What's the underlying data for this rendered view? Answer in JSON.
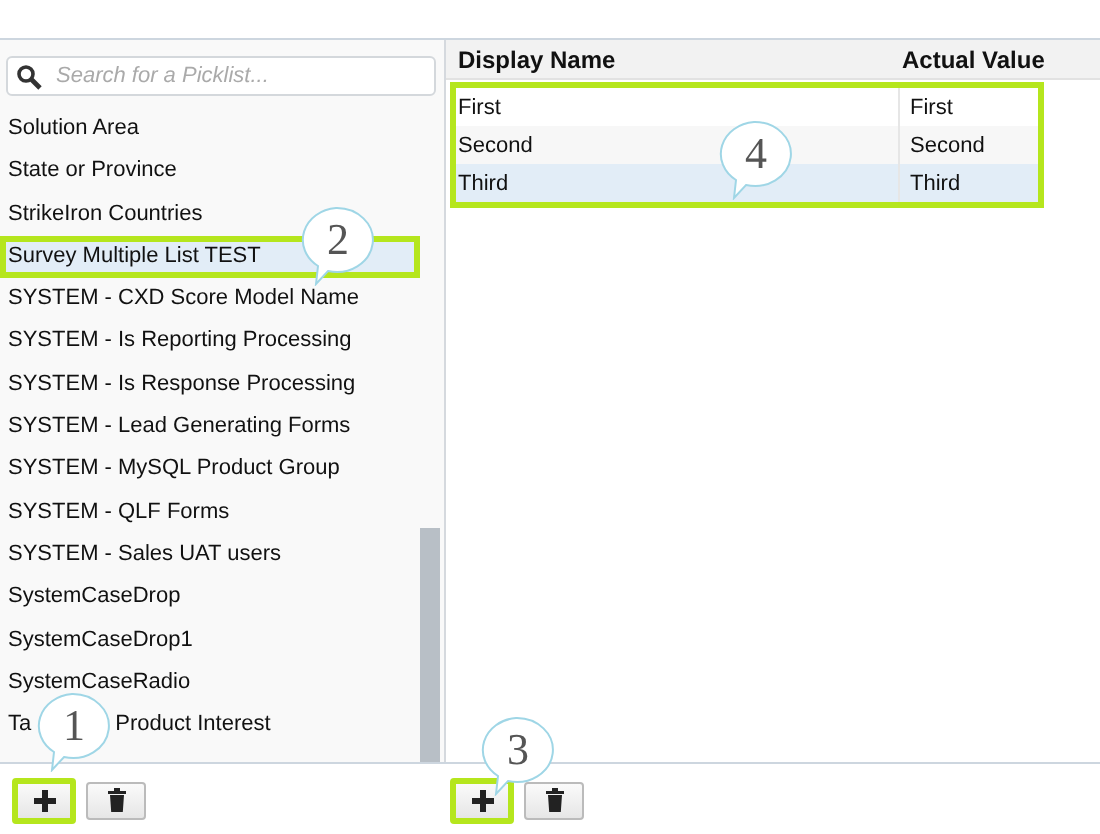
{
  "search": {
    "placeholder": "Search for a Picklist..."
  },
  "picklists": [
    {
      "label": "Solution Area",
      "selected": false,
      "highlighted": false
    },
    {
      "label": "State or Province",
      "selected": false,
      "highlighted": false
    },
    {
      "label": "StrikeIron Countries",
      "selected": false,
      "highlighted": false
    },
    {
      "label": "Survey Multiple List TEST",
      "selected": true,
      "highlighted": true
    },
    {
      "label": "SYSTEM - CXD Score Model Name",
      "selected": false,
      "highlighted": false
    },
    {
      "label": "SYSTEM - Is Reporting Processing",
      "selected": false,
      "highlighted": false
    },
    {
      "label": "SYSTEM - Is Response Processing",
      "selected": false,
      "highlighted": false
    },
    {
      "label": "SYSTEM - Lead Generating Forms",
      "selected": false,
      "highlighted": false
    },
    {
      "label": "SYSTEM - MySQL Product Group",
      "selected": false,
      "highlighted": false
    },
    {
      "label": "SYSTEM - QLF Forms",
      "selected": false,
      "highlighted": false
    },
    {
      "label": "SYSTEM - Sales UAT users",
      "selected": false,
      "highlighted": false
    },
    {
      "label": "SystemCaseDrop",
      "selected": false,
      "highlighted": false
    },
    {
      "label": "SystemCaseDrop1",
      "selected": false,
      "highlighted": false
    },
    {
      "label": "SystemCaseRadio",
      "selected": false,
      "highlighted": false
    },
    {
      "label": "Ta",
      "label_after_callout": "Product Interest",
      "selected": false,
      "highlighted": false
    }
  ],
  "values_table": {
    "columns": [
      "Display Name",
      "Actual Value"
    ],
    "highlighted": true,
    "rows": [
      {
        "cells": [
          "First",
          "First"
        ],
        "selected": false
      },
      {
        "cells": [
          "Second",
          "Second"
        ],
        "selected": false
      },
      {
        "cells": [
          "Third",
          "Third"
        ],
        "selected": true
      }
    ]
  },
  "left_toolbar": [
    {
      "kind": "add",
      "highlighted": true
    },
    {
      "kind": "delete",
      "highlighted": false
    }
  ],
  "right_toolbar": [
    {
      "kind": "add",
      "highlighted": true
    },
    {
      "kind": "delete",
      "highlighted": false
    }
  ],
  "callouts": [
    {
      "number": "1"
    },
    {
      "number": "2"
    },
    {
      "number": "3"
    },
    {
      "number": "4"
    }
  ]
}
